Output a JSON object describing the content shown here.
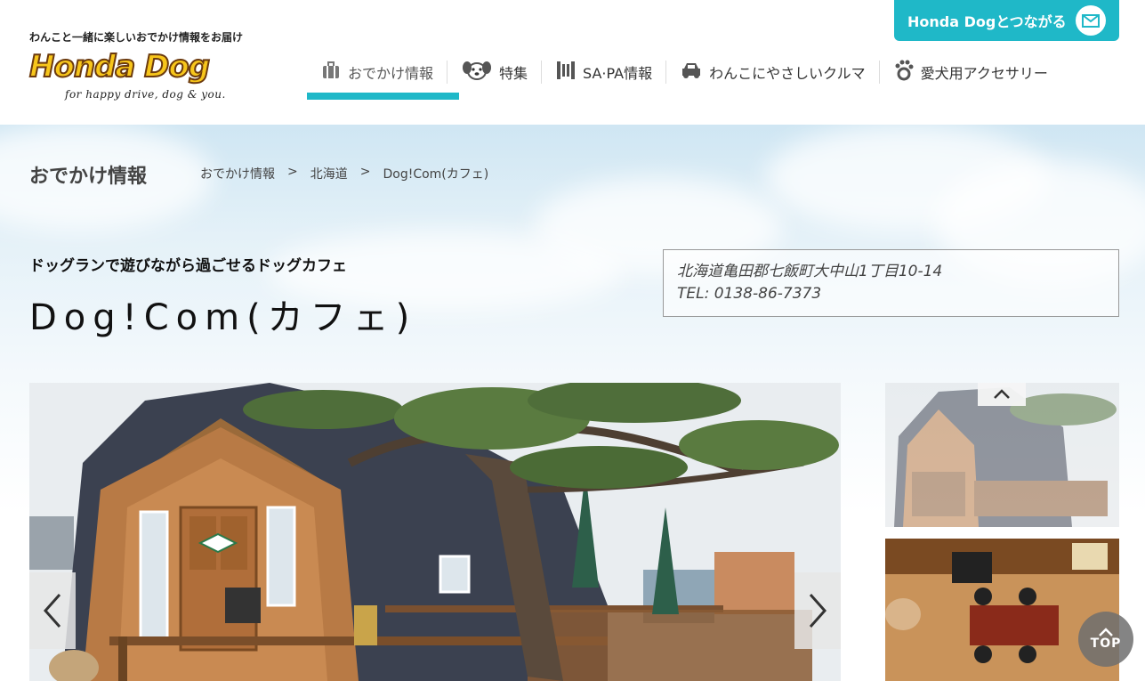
{
  "header": {
    "tagline": "わんこと一緒に楽しいおでかけ情報をお届け",
    "logo_text": "Honda Dog",
    "logo_sub": "for happy drive, dog & you.",
    "connect_button": "Honda Dogとつながる"
  },
  "nav": {
    "items": [
      {
        "label": "おでかけ情報",
        "icon": "suitcase-icon"
      },
      {
        "label": "特集",
        "icon": "dog-face-icon"
      },
      {
        "label": "SA·PA情報",
        "icon": "building-icon"
      },
      {
        "label": "わんこにやさしいクルマ",
        "icon": "car-icon"
      },
      {
        "label": "愛犬用アクセサリー",
        "icon": "paw-icon"
      }
    ]
  },
  "page": {
    "section_title": "おでかけ情報",
    "breadcrumb": [
      "おでかけ情報",
      ">",
      "北海道",
      ">",
      "Dog!Com(カフェ)"
    ],
    "subtitle": "ドッグランで遊びながら過ごせるドッグカフェ",
    "name": "Dog!Com(カフェ)",
    "address": "北海道亀田郡七飯町大中山1丁目10-14",
    "tel": "TEL: 0138-86-7373"
  },
  "top_button": "TOP",
  "colors": {
    "accent": "#1fb8c8",
    "logo_yellow": "#f7c61b",
    "logo_brown": "#6b3a0e"
  }
}
